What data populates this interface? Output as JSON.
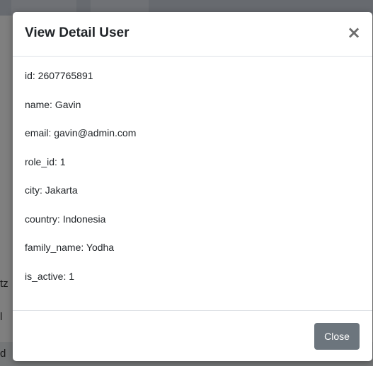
{
  "background": {
    "left_fragments": [
      "tz",
      "l",
      "d"
    ]
  },
  "modal": {
    "title": "View Detail User",
    "close_icon_glyph": "×",
    "fields": [
      "id: 2607765891",
      "name: Gavin",
      "email: gavin@admin.com",
      "role_id: 1",
      "city: Jakarta",
      "country: Indonesia",
      "family_name: Yodha",
      "is_active: 1"
    ],
    "close_button_label": "Close"
  }
}
